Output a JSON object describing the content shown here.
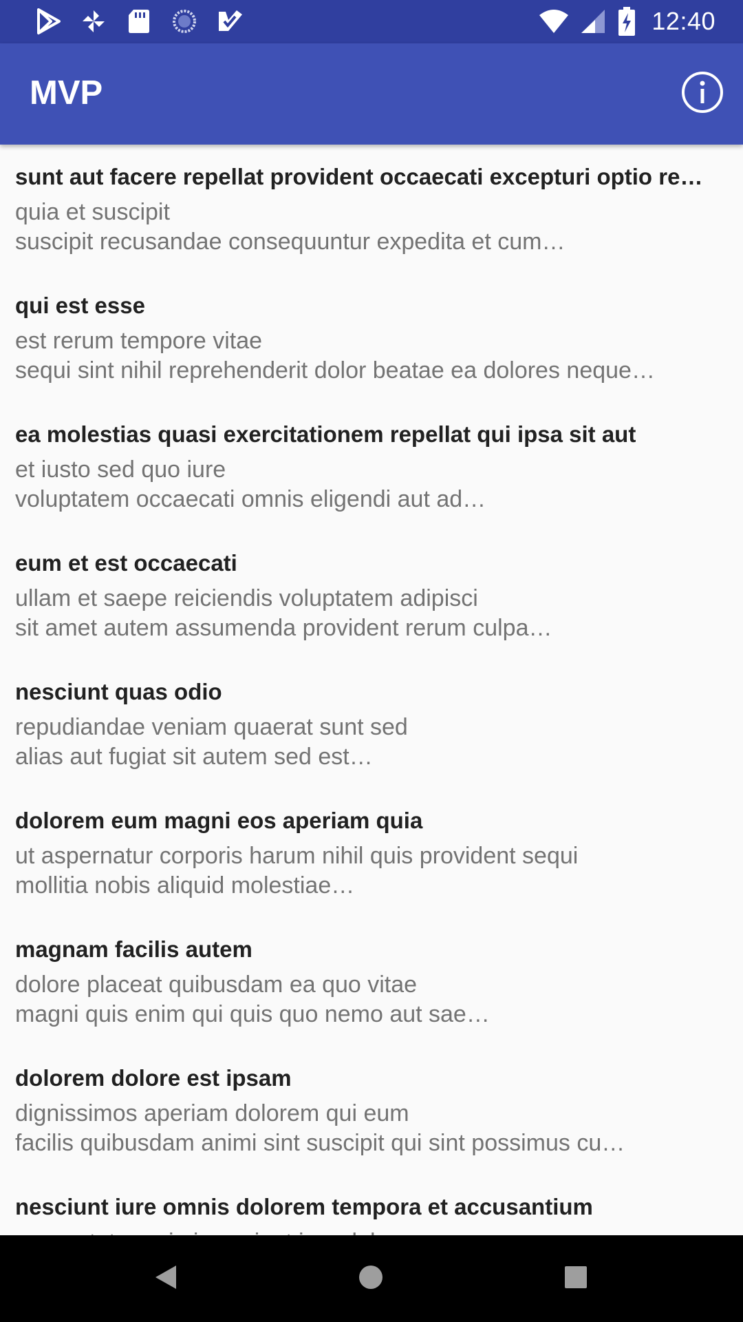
{
  "status_bar": {
    "time": "12:40",
    "left_icons": [
      "play-store-icon",
      "pinwheel-icon",
      "sd-card-icon",
      "sync-circle-icon",
      "checkmark-app-icon"
    ],
    "right_icons": [
      "wifi-icon",
      "cell-signal-icon",
      "battery-charging-icon"
    ]
  },
  "app_bar": {
    "title": "MVP",
    "action_icon": "info-icon"
  },
  "posts": [
    {
      "title": "sunt aut facere repellat provident occaecati excepturi optio re…",
      "body_line1": "quia et suscipit",
      "body_line2": "suscipit recusandae consequuntur expedita et cum…"
    },
    {
      "title": "qui est esse",
      "body_line1": "est rerum tempore vitae",
      "body_line2": "sequi sint nihil reprehenderit dolor beatae ea dolores neque…"
    },
    {
      "title": "ea molestias quasi exercitationem repellat qui ipsa sit aut",
      "body_line1": "et iusto sed quo iure",
      "body_line2": "voluptatem occaecati omnis eligendi aut ad…"
    },
    {
      "title": "eum et est occaecati",
      "body_line1": "ullam et saepe reiciendis voluptatem adipisci",
      "body_line2": "sit amet autem assumenda provident rerum culpa…"
    },
    {
      "title": "nesciunt quas odio",
      "body_line1": "repudiandae veniam quaerat sunt sed",
      "body_line2": "alias aut fugiat sit autem sed est…"
    },
    {
      "title": "dolorem eum magni eos aperiam quia",
      "body_line1": "ut aspernatur corporis harum nihil quis provident sequi",
      "body_line2": "mollitia nobis aliquid molestiae…"
    },
    {
      "title": "magnam facilis autem",
      "body_line1": "dolore placeat quibusdam ea quo vitae",
      "body_line2": "magni quis enim qui quis quo nemo aut sae…"
    },
    {
      "title": "dolorem dolore est ipsam",
      "body_line1": "dignissimos aperiam dolorem qui eum",
      "body_line2": "facilis quibusdam animi sint suscipit qui sint possimus cu…"
    },
    {
      "title": "nesciunt iure omnis dolorem tempora et accusantium",
      "body_line1": "consectetur animi nesciunt iure dolore",
      "body_line2": ""
    }
  ],
  "nav_bar": {
    "icons": [
      "back-icon",
      "home-icon",
      "recents-icon"
    ]
  },
  "colors": {
    "status_bar": "#303f9f",
    "app_bar": "#3f51b5",
    "background": "#fafafa",
    "title_text": "#212121",
    "body_text": "#737373",
    "nav_bar": "#000000",
    "nav_icon": "#9e9e9e"
  }
}
